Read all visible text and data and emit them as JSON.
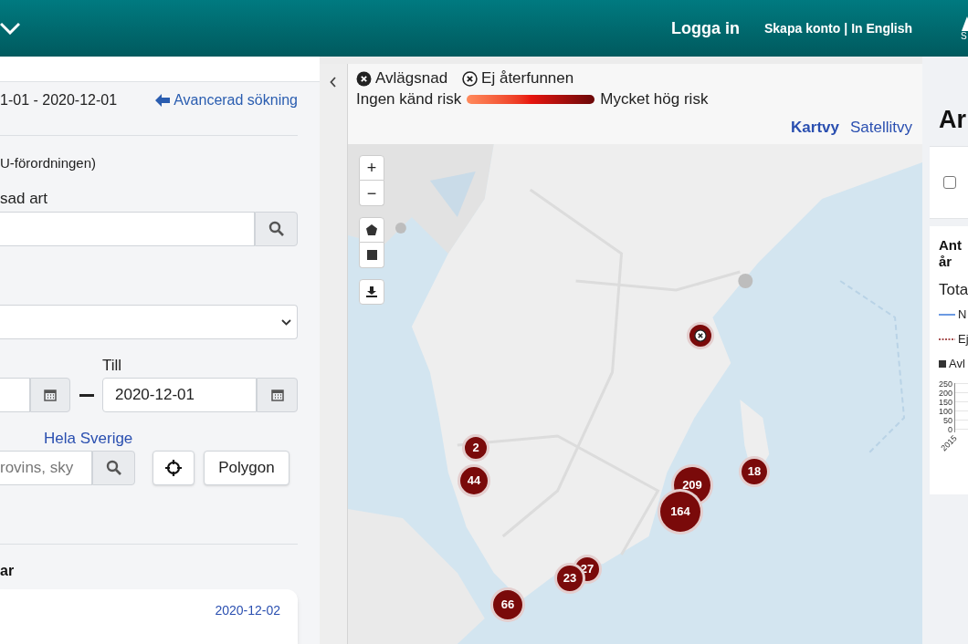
{
  "header": {
    "login": "Logga in",
    "create_account": "Skapa konto",
    "separator": "|",
    "language": "In English",
    "logo_letter": "S"
  },
  "search_panel": {
    "date_summary": "1-01 - 2020-12-01",
    "advanced_link": "Avancerad sökning",
    "regulation_text": "U-förordningen)",
    "species_label": "sad art",
    "till_label": "Till",
    "to_date": "2020-12-01",
    "region_link": "Hela Sverige",
    "location_placeholder": "rovins, sky",
    "polygon_button": "Polygon",
    "section_title": "ar",
    "card_date": "2020-12-02"
  },
  "map": {
    "legend": [
      {
        "kind": "removed",
        "label": "Avlägsnad"
      },
      {
        "kind": "not_found",
        "label": "Ej återfunnen"
      }
    ],
    "risk_low": "Ingen känd risk",
    "risk_high": "Mycket hög risk",
    "view_tabs": [
      {
        "label": "Kartvy",
        "selected": true
      },
      {
        "label": "Satellitvy",
        "selected": false
      }
    ],
    "zoom_in": "+",
    "zoom_out": "−",
    "markers": [
      {
        "kind": "not_found"
      },
      {
        "kind": "cluster",
        "count": "2"
      },
      {
        "kind": "cluster",
        "count": "18"
      },
      {
        "kind": "cluster",
        "count": "44"
      },
      {
        "kind": "cluster",
        "count": "209"
      },
      {
        "kind": "cluster",
        "count": "164"
      },
      {
        "kind": "cluster",
        "count": "27"
      },
      {
        "kind": "cluster",
        "count": "23"
      },
      {
        "kind": "cluster",
        "count": "66"
      }
    ]
  },
  "right_panel": {
    "heading": "Ar",
    "checkbox": {
      "checked": false
    },
    "card_title": [
      "Ant",
      "år"
    ],
    "total": "Tota",
    "legend": [
      {
        "kind": "solid",
        "label": "N"
      },
      {
        "kind": "dashed",
        "label": "Ej"
      },
      {
        "kind": "square",
        "label": "Avl"
      }
    ],
    "y_ticks": [
      "250",
      "200",
      "150",
      "100",
      "50",
      "0"
    ],
    "x_tick": "2015"
  }
}
